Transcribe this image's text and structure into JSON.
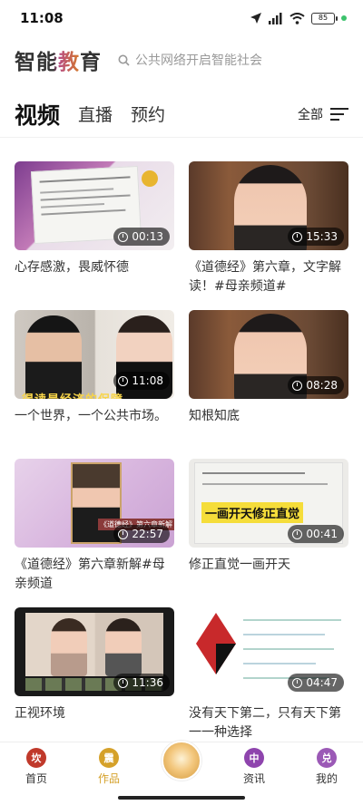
{
  "status": {
    "time": "11:08",
    "battery": "85"
  },
  "header": {
    "logo": "智能教育",
    "search_placeholder": "公共网络开启智能社会"
  },
  "tabs": [
    {
      "label": "视频"
    },
    {
      "label": "直播"
    },
    {
      "label": "预约"
    }
  ],
  "filter": {
    "label": "全部"
  },
  "videos": [
    {
      "title": "心存感激，畏威怀德",
      "duration": "00:13"
    },
    {
      "title": "《道德经》第六章，文字解读！#母亲频道#",
      "duration": "15:33"
    },
    {
      "title": "一个世界，一个公共市场。",
      "duration": "11:08"
    },
    {
      "title": "知根知底",
      "duration": "08:28"
    },
    {
      "title": "《道德经》第六章新解#母亲频道",
      "duration": "22:57"
    },
    {
      "title": "修正直觉一画开天",
      "duration": "00:41"
    },
    {
      "title": "正视环境",
      "duration": "11:36"
    },
    {
      "title": "没有天下第二，只有天下第一一种选择",
      "duration": "04:47"
    }
  ],
  "thumbnail_text": {
    "v3": "得读是经济的保障",
    "v5": "《道德经》第六章新解",
    "v6": "一画开天修正直觉"
  },
  "bottom_nav": [
    {
      "label": "首页",
      "icon": "home-icon",
      "glyph": "坎",
      "color": "#c0392b"
    },
    {
      "label": "作品",
      "icon": "works-icon",
      "glyph": "震",
      "color": "#d5a12a"
    },
    {
      "label": "资讯",
      "icon": "news-icon",
      "glyph": "中",
      "color": "#8e44ad"
    },
    {
      "label": "我的",
      "icon": "profile-icon",
      "glyph": "兑",
      "color": "#9b59b6"
    }
  ],
  "colors": {
    "accent": "#d5a12a",
    "tab_active": "#111111"
  }
}
